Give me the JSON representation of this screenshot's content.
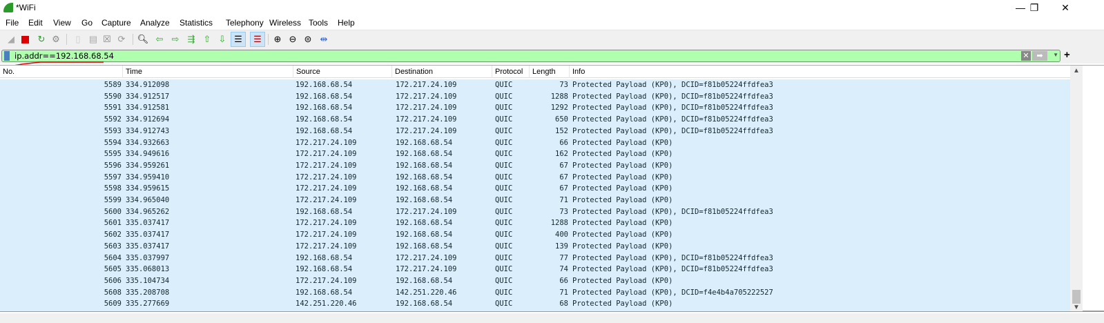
{
  "window": {
    "title": "*WiFi",
    "minimize": "—",
    "maximize": "❐",
    "close": "✕"
  },
  "menu": [
    "File",
    "Edit",
    "View",
    "Go",
    "Capture",
    "Analyze",
    "Statistics",
    "Telephony",
    "Wireless",
    "Tools",
    "Help"
  ],
  "filter": {
    "value": "ip.addr==192.168.68.54",
    "clear": "✕",
    "apply": "➡",
    "dropdown": "▼",
    "add": "+"
  },
  "columns": [
    "No.",
    "Time",
    "Source",
    "Destination",
    "Protocol",
    "Length",
    "Info"
  ],
  "packets": [
    [
      "5589",
      "334.912098",
      "192.168.68.54",
      "172.217.24.109",
      "QUIC",
      "73",
      "Protected Payload (KP0), DCID=f81b05224ffdfea3"
    ],
    [
      "5590",
      "334.912517",
      "192.168.68.54",
      "172.217.24.109",
      "QUIC",
      "1288",
      "Protected Payload (KP0), DCID=f81b05224ffdfea3"
    ],
    [
      "5591",
      "334.912581",
      "192.168.68.54",
      "172.217.24.109",
      "QUIC",
      "1292",
      "Protected Payload (KP0), DCID=f81b05224ffdfea3"
    ],
    [
      "5592",
      "334.912694",
      "192.168.68.54",
      "172.217.24.109",
      "QUIC",
      "650",
      "Protected Payload (KP0), DCID=f81b05224ffdfea3"
    ],
    [
      "5593",
      "334.912743",
      "192.168.68.54",
      "172.217.24.109",
      "QUIC",
      "152",
      "Protected Payload (KP0), DCID=f81b05224ffdfea3"
    ],
    [
      "5594",
      "334.932663",
      "172.217.24.109",
      "192.168.68.54",
      "QUIC",
      "66",
      "Protected Payload (KP0)"
    ],
    [
      "5595",
      "334.949616",
      "172.217.24.109",
      "192.168.68.54",
      "QUIC",
      "162",
      "Protected Payload (KP0)"
    ],
    [
      "5596",
      "334.959261",
      "172.217.24.109",
      "192.168.68.54",
      "QUIC",
      "67",
      "Protected Payload (KP0)"
    ],
    [
      "5597",
      "334.959410",
      "172.217.24.109",
      "192.168.68.54",
      "QUIC",
      "67",
      "Protected Payload (KP0)"
    ],
    [
      "5598",
      "334.959615",
      "172.217.24.109",
      "192.168.68.54",
      "QUIC",
      "67",
      "Protected Payload (KP0)"
    ],
    [
      "5599",
      "334.965040",
      "172.217.24.109",
      "192.168.68.54",
      "QUIC",
      "71",
      "Protected Payload (KP0)"
    ],
    [
      "5600",
      "334.965262",
      "192.168.68.54",
      "172.217.24.109",
      "QUIC",
      "73",
      "Protected Payload (KP0), DCID=f81b05224ffdfea3"
    ],
    [
      "5601",
      "335.037417",
      "172.217.24.109",
      "192.168.68.54",
      "QUIC",
      "1288",
      "Protected Payload (KP0)"
    ],
    [
      "5602",
      "335.037417",
      "172.217.24.109",
      "192.168.68.54",
      "QUIC",
      "400",
      "Protected Payload (KP0)"
    ],
    [
      "5603",
      "335.037417",
      "172.217.24.109",
      "192.168.68.54",
      "QUIC",
      "139",
      "Protected Payload (KP0)"
    ],
    [
      "5604",
      "335.037997",
      "192.168.68.54",
      "172.217.24.109",
      "QUIC",
      "77",
      "Protected Payload (KP0), DCID=f81b05224ffdfea3"
    ],
    [
      "5605",
      "335.068013",
      "192.168.68.54",
      "172.217.24.109",
      "QUIC",
      "74",
      "Protected Payload (KP0), DCID=f81b05224ffdfea3"
    ],
    [
      "5606",
      "335.104734",
      "172.217.24.109",
      "192.168.68.54",
      "QUIC",
      "66",
      "Protected Payload (KP0)"
    ],
    [
      "5608",
      "335.208708",
      "192.168.68.54",
      "142.251.220.46",
      "QUIC",
      "71",
      "Protected Payload (KP0), DCID=f4e4b4a705222527"
    ],
    [
      "5609",
      "335.277669",
      "142.251.220.46",
      "192.168.68.54",
      "QUIC",
      "68",
      "Protected Payload (KP0)"
    ]
  ],
  "colors": {
    "row_bg": "#daeefc",
    "filter_bg": "#afffaf",
    "annotation": "#e00000"
  }
}
